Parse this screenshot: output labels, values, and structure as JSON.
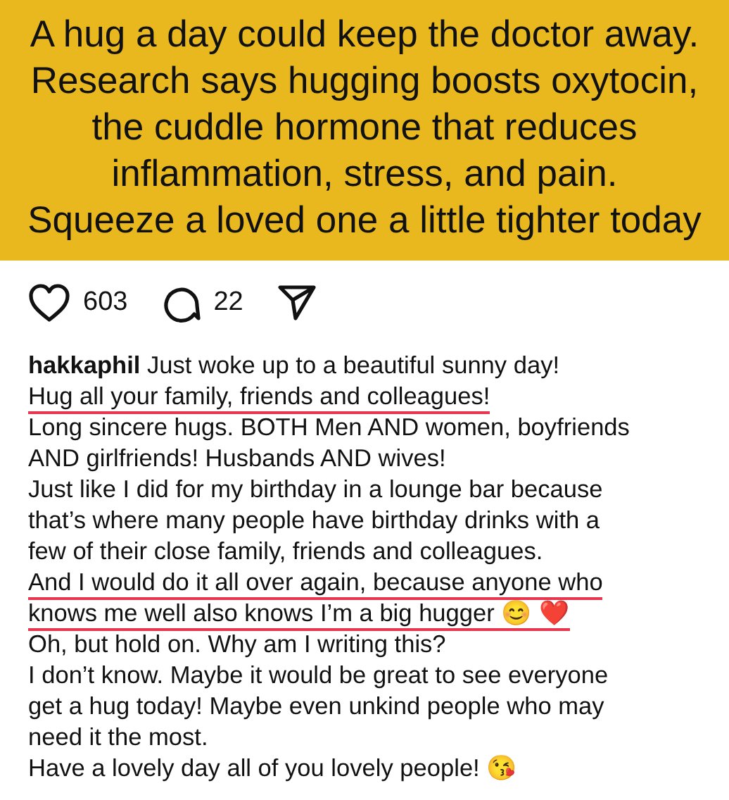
{
  "banner": {
    "lines": [
      "A hug a day could keep the doctor away.",
      "Research says hugging boosts oxytocin,",
      "the cuddle hormone that reduces",
      "inflammation, stress, and pain.",
      "Squeeze a loved one a little tighter today"
    ]
  },
  "actions": {
    "likes": "603",
    "comments": "22"
  },
  "caption": [
    {
      "text": "**hakkaphil** Just woke up to a beautiful sunny day!",
      "underlined": false
    },
    {
      "text": "Hug all your family, friends and colleagues!",
      "underlined": true
    },
    {
      "text": "Long sincere hugs. BOTH Men AND women, boyfriends",
      "underlined": false
    },
    {
      "text": "AND girlfriends! Husbands AND wives!",
      "underlined": false
    },
    {
      "text": "Just like I did for my birthday in a lounge bar because",
      "underlined": false
    },
    {
      "text": "that’s where many people have birthday drinks with a",
      "underlined": false
    },
    {
      "text": "few of their close family, friends and colleagues.",
      "underlined": false
    },
    {
      "text": "And I would do it all over again, because anyone who",
      "underlined": true
    },
    {
      "text": "knows me well also knows I’m a big hugger 😊 ❤️",
      "underlined": true
    },
    {
      "text": "Oh, but hold on. Why am I writing this?",
      "underlined": false
    },
    {
      "text": "I don’t know. Maybe it would be great to see everyone",
      "underlined": false
    },
    {
      "text": "get a hug today! Maybe even unkind people who may",
      "underlined": false
    },
    {
      "text": "need it the most.",
      "underlined": false
    },
    {
      "text": "Have a lovely day all of you lovely people! 😘",
      "underlined": false
    }
  ]
}
